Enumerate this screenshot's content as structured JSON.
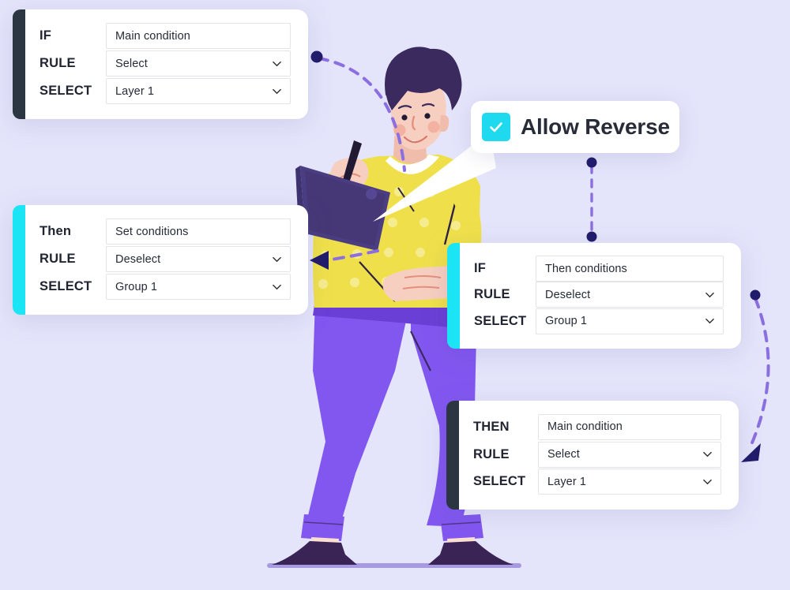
{
  "page": {
    "background_color": "#e4e4fb",
    "ground_line_color": "#a89ae0"
  },
  "callout": {
    "checkbox_icon": "check-icon",
    "checkbox_color": "#1fd9ef",
    "label": "Allow Reverse",
    "checked": true
  },
  "cards": [
    {
      "id": "card-main-condition",
      "accent_color": "#2b3642",
      "rows": [
        {
          "label": "IF",
          "value": "Main condition",
          "type": "text",
          "icon": null
        },
        {
          "label": "RULE",
          "value": "Select",
          "type": "select",
          "icon": "chevron-down-icon"
        },
        {
          "label": "SELECT",
          "value": "Layer 1",
          "type": "select",
          "icon": "chevron-down-icon"
        }
      ]
    },
    {
      "id": "card-set-conditions",
      "accent_color": "#1be5f5",
      "rows": [
        {
          "label": "Then",
          "value": "Set conditions",
          "type": "text",
          "icon": null
        },
        {
          "label": "RULE",
          "value": "Deselect",
          "type": "select",
          "icon": "chevron-down-icon"
        },
        {
          "label": "SELECT",
          "value": "Group 1",
          "type": "select",
          "icon": "chevron-down-icon"
        }
      ]
    },
    {
      "id": "card-then-conditions",
      "accent_color": "#1be5f5",
      "rows": [
        {
          "label": "IF",
          "value": "Then conditions",
          "type": "text",
          "icon": null
        },
        {
          "label": "RULE",
          "value": "Deselect",
          "type": "select",
          "icon": "chevron-down-icon"
        },
        {
          "label": "SELECT",
          "value": "Group 1",
          "type": "select",
          "icon": "chevron-down-icon"
        }
      ]
    },
    {
      "id": "card-then-main-condition",
      "accent_color": "#2b3642",
      "rows": [
        {
          "label": "THEN",
          "value": "Main condition",
          "type": "text",
          "icon": null
        },
        {
          "label": "RULE",
          "value": "Select",
          "type": "select",
          "icon": "chevron-down-icon"
        },
        {
          "label": "SELECT",
          "value": "Layer 1",
          "type": "select",
          "icon": "chevron-down-icon"
        }
      ]
    }
  ],
  "connectors": {
    "dash_color": "#8b6fe0",
    "dot_color": "#211b6b",
    "arrow_color": "#211b6b",
    "items": [
      {
        "name": "arc-top-left",
        "from": "dot",
        "to": "head",
        "shape": "arc"
      },
      {
        "name": "line-right-vertical",
        "from": "dot",
        "to": "dot",
        "shape": "dashed-line"
      },
      {
        "name": "arc-right-down",
        "from": "dot",
        "to": "arrowhead",
        "shape": "arc"
      },
      {
        "name": "arrow-to-card-2",
        "from": "figure",
        "to": "arrowhead",
        "shape": "dashed-line"
      }
    ]
  },
  "illustration": {
    "name": "man-with-tablet",
    "colors": {
      "hair": "#3b2a5e",
      "skin": "#f7cfc0",
      "shirt": "#efe04b",
      "shirt_dots": "#f5ec8f",
      "pants": "#8257f0",
      "pants_shade": "#6a3fd6",
      "shoes": "#3a2456",
      "tablet": "#4a3d82",
      "tablet_dark": "#413472"
    }
  }
}
